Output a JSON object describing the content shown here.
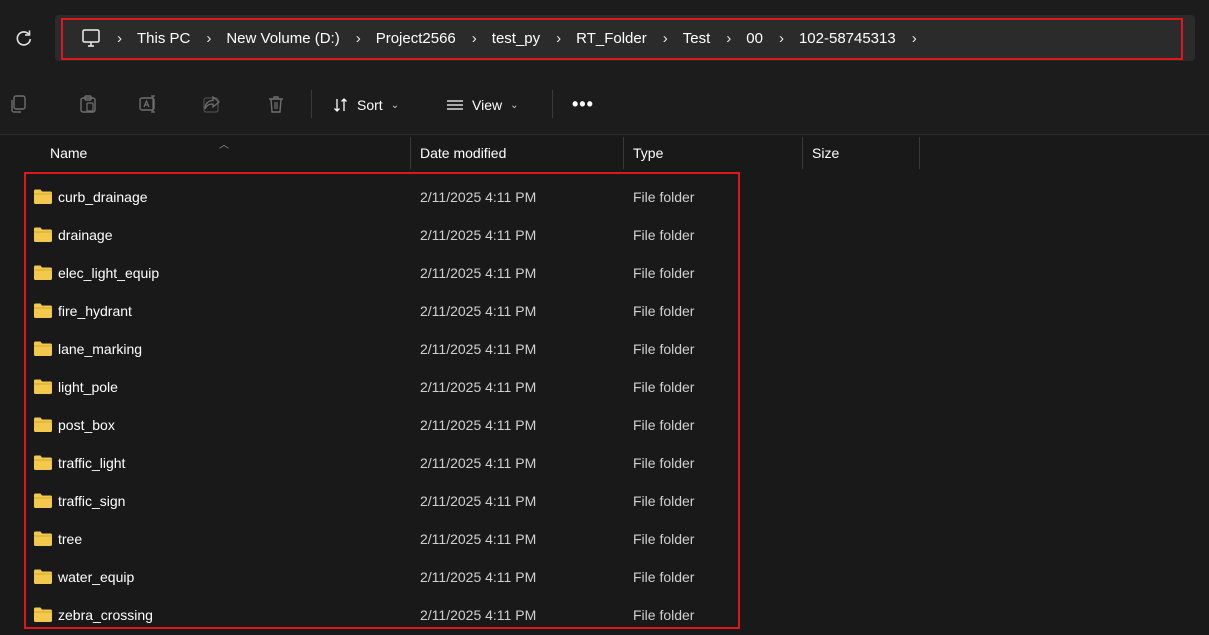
{
  "breadcrumb": [
    "This PC",
    "New Volume (D:)",
    "Project2566",
    "test_py",
    "RT_Folder",
    "Test",
    "00",
    "102-58745313"
  ],
  "toolbar": {
    "sort_label": "Sort",
    "view_label": "View",
    "more_label": "•••"
  },
  "columns": {
    "name": "Name",
    "date": "Date modified",
    "type": "Type",
    "size": "Size"
  },
  "rows": [
    {
      "name": "curb_drainage",
      "date": "2/11/2025 4:11 PM",
      "type": "File folder"
    },
    {
      "name": "drainage",
      "date": "2/11/2025 4:11 PM",
      "type": "File folder"
    },
    {
      "name": "elec_light_equip",
      "date": "2/11/2025 4:11 PM",
      "type": "File folder"
    },
    {
      "name": "fire_hydrant",
      "date": "2/11/2025 4:11 PM",
      "type": "File folder"
    },
    {
      "name": "lane_marking",
      "date": "2/11/2025 4:11 PM",
      "type": "File folder"
    },
    {
      "name": "light_pole",
      "date": "2/11/2025 4:11 PM",
      "type": "File folder"
    },
    {
      "name": "post_box",
      "date": "2/11/2025 4:11 PM",
      "type": "File folder"
    },
    {
      "name": "traffic_light",
      "date": "2/11/2025 4:11 PM",
      "type": "File folder"
    },
    {
      "name": "traffic_sign",
      "date": "2/11/2025 4:11 PM",
      "type": "File folder"
    },
    {
      "name": "tree",
      "date": "2/11/2025 4:11 PM",
      "type": "File folder"
    },
    {
      "name": "water_equip",
      "date": "2/11/2025 4:11 PM",
      "type": "File folder"
    },
    {
      "name": "zebra_crossing",
      "date": "2/11/2025 4:11 PM",
      "type": "File folder"
    }
  ],
  "colors": {
    "highlight": "#e0161b",
    "folder": "#f2c94c",
    "background": "#191919"
  }
}
